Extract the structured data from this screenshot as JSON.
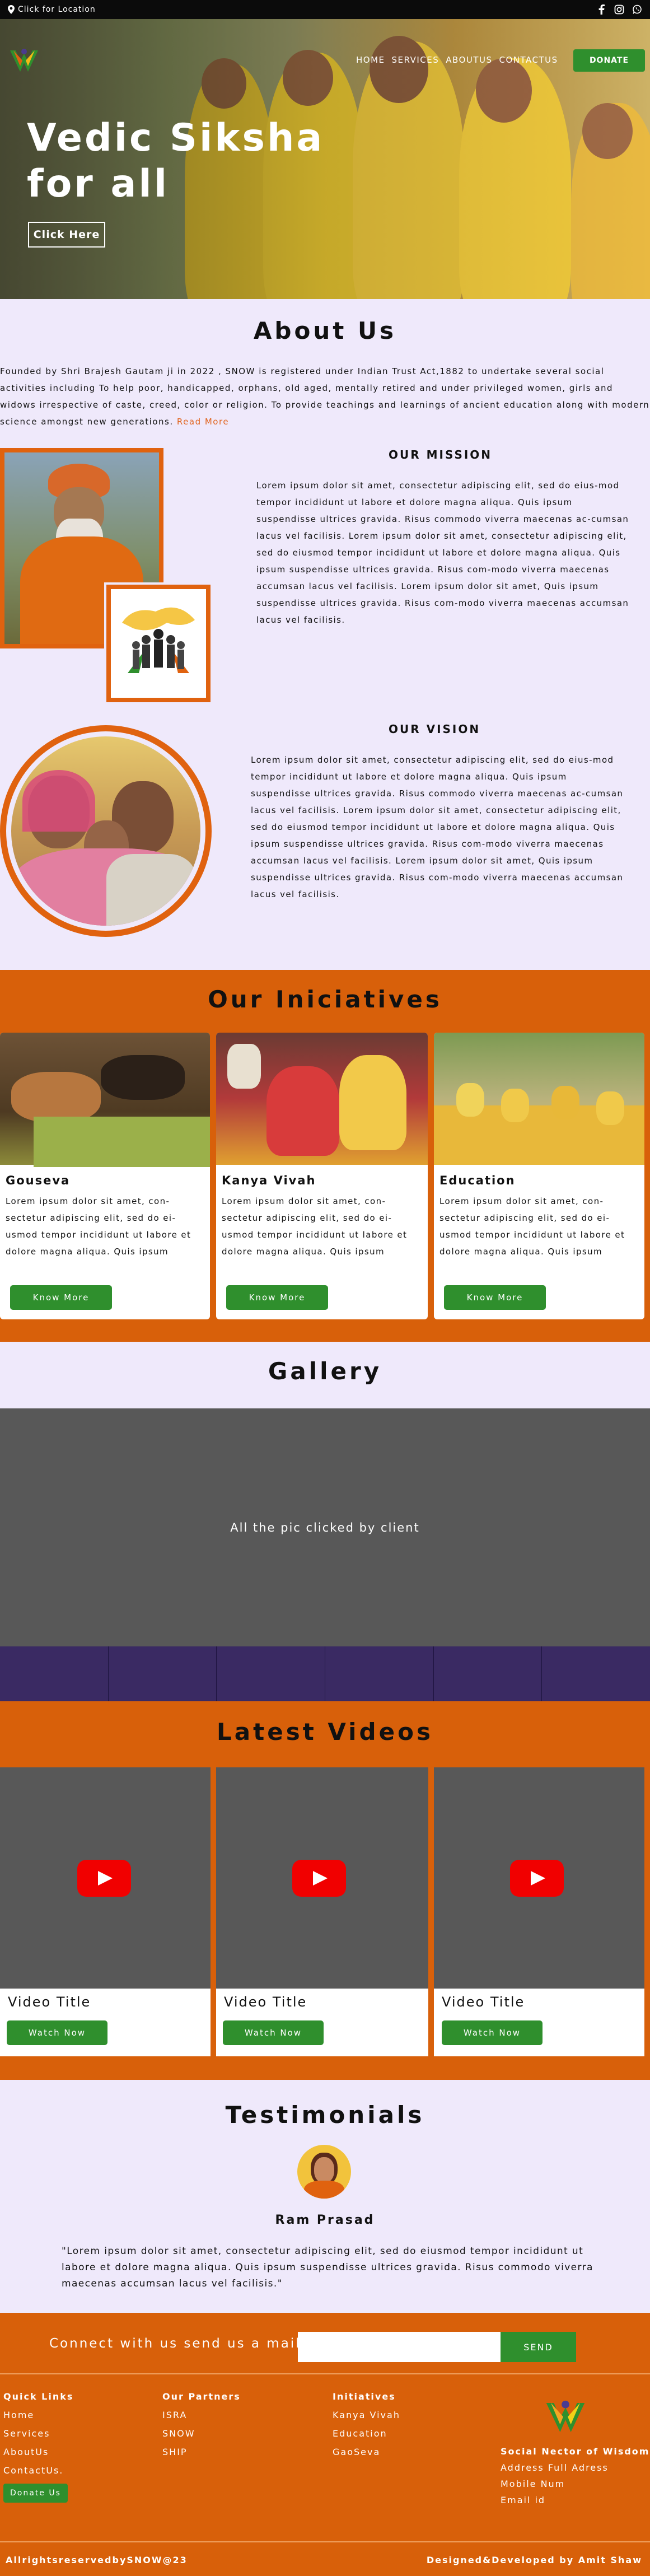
{
  "topbar": {
    "location_label": "Click for Location"
  },
  "nav": {
    "items": [
      "HOME",
      "SERVICES",
      "ABOUTUS",
      "CONTACTUS"
    ],
    "donate_label": "DONATE"
  },
  "hero": {
    "title_line1": "Vedic Siksha",
    "title_line2": "for all",
    "cta_label": "Click Here"
  },
  "about": {
    "heading": "About Us",
    "text": "Founded by Shri Brajesh Gautam ji in 2022 , SNOW is registered under Indian Trust Act,1882 to undertake several social activities including To help poor, handicapped, orphans, old aged, mentally retired and under privileged women, girls and widows irrespective of caste, creed, color or religion. To provide teachings and learnings of ancient education along with modern science amongst new generations.",
    "read_more": "Read More",
    "mission_heading": "OUR MISSION",
    "mission_text": "Lorem ipsum dolor sit amet, consectetur adipiscing elit, sed do eius-mod tempor incididunt ut labore et dolore magna aliqua. Quis ipsum suspendisse ultrices gravida. Risus commodo viverra maecenas ac-cumsan lacus vel facilisis. Lorem ipsum dolor sit amet, consectetur adipiscing elit, sed do eiusmod tempor incididunt ut labore et dolore magna aliqua. Quis ipsum suspendisse ultrices gravida. Risus com-modo viverra maecenas accumsan lacus vel facilisis. Lorem ipsum dolor sit amet, Quis ipsum suspendisse ultrices gravida. Risus com-modo viverra maecenas accumsan lacus vel facilisis.",
    "vision_heading": "OUR VISION",
    "vision_text": "Lorem ipsum dolor sit amet, consectetur adipiscing elit, sed do eius-mod tempor incididunt ut labore et dolore magna aliqua. Quis ipsum suspendisse ultrices gravida. Risus commodo viverra maecenas ac-cumsan lacus vel facilisis. Lorem ipsum dolor sit amet, consectetur adipiscing elit, sed do eiusmod tempor incididunt ut labore et dolore magna aliqua. Quis ipsum suspendisse ultrices gravida. Risus com-modo viverra maecenas accumsan lacus vel facilisis. Lorem ipsum dolor sit amet, Quis ipsum suspendisse ultrices gravida. Risus com-modo viverra maecenas accumsan lacus vel facilisis."
  },
  "initiatives": {
    "heading": "Our Iniciatives",
    "cards": [
      {
        "title": "Gouseva",
        "text": "Lorem ipsum dolor sit amet, con-sectetur adipiscing elit, sed do ei-usmod tempor incididunt ut labore et dolore magna aliqua. Quis ipsum suspendisse ultrices gravida. Risus",
        "button": "Know More"
      },
      {
        "title": "Kanya Vivah",
        "text": "Lorem ipsum dolor sit amet, con-sectetur adipiscing elit, sed do ei-usmod tempor incididunt ut labore et dolore magna aliqua. Quis ipsum suspendisse ultrices gravida. Risus",
        "button": "Know More"
      },
      {
        "title": "Education",
        "text": "Lorem ipsum dolor sit amet, con-sectetur adipiscing elit, sed do ei-usmod tempor incididunt ut labore et dolore magna aliqua. Quis ipsum suspendisse ultrices gravida. Risus",
        "button": "Know More"
      }
    ]
  },
  "gallery": {
    "heading": "Gallery",
    "caption": "All the pic clicked by client"
  },
  "videos": {
    "heading": "Latest Videos",
    "items": [
      {
        "title": "Video Title",
        "button": "Watch Now"
      },
      {
        "title": "Video Title",
        "button": "Watch Now"
      },
      {
        "title": "Video Title",
        "button": "Watch Now"
      }
    ]
  },
  "testimonials": {
    "heading": "Testimonials",
    "name": "Ram Prasad",
    "quote": "\"Lorem ipsum dolor sit amet, consectetur adipiscing elit, sed do eiusmod tempor incididunt ut labore et dolore magna aliqua. Quis ipsum suspendisse ultrices gravida. Risus commodo viverra maecenas accumsan lacus vel facilisis.\""
  },
  "footer": {
    "newsletter_label": "Connect with us send us a mail",
    "send_label": "SEND",
    "quick_links": {
      "heading": "Quick Links",
      "items": [
        "Home",
        "Services",
        "AboutUs",
        "ContactUs."
      ],
      "donate": "Donate Us"
    },
    "partners": {
      "heading": "Our Partners",
      "items": [
        "ISRA",
        "SNOW",
        "SHIP"
      ]
    },
    "initiatives": {
      "heading": "Initiatives",
      "items": [
        "Kanya Vivah",
        "Education",
        "GaoSeva"
      ]
    },
    "org": {
      "name": "Social Nector of Wisdom",
      "items": [
        "Address Full Adress",
        "Mobile Num",
        "Email id"
      ]
    },
    "copyright": "AllrightsreservedbySNOW@23",
    "developer": "Designed&Developed by Amit Shaw"
  },
  "colors": {
    "accent_orange": "#d8600a",
    "button_green": "#2f8f2d",
    "page_bg": "#efe9fb",
    "youtube_red": "#f10000"
  }
}
